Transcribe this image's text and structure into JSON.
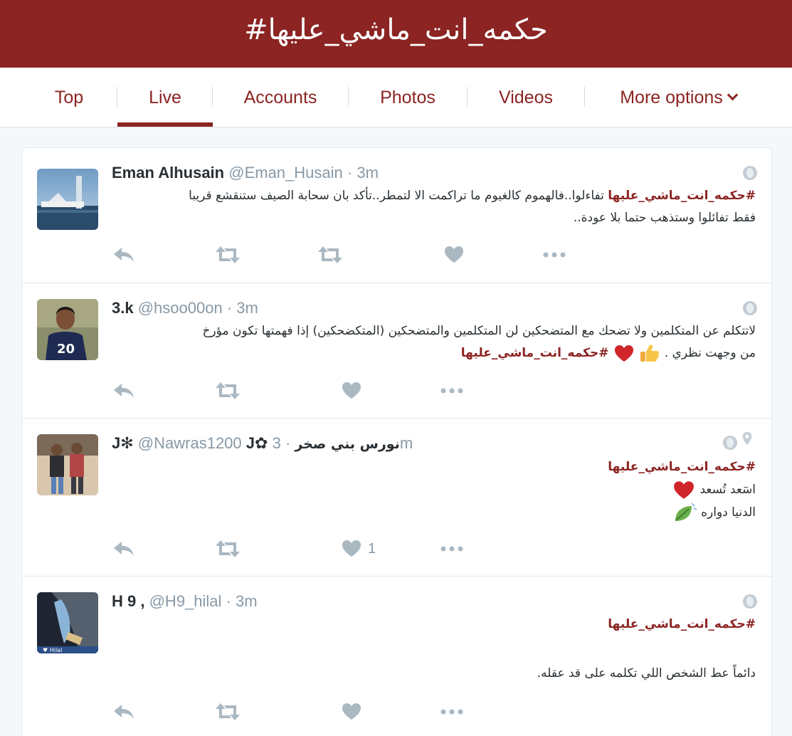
{
  "header": {
    "title": "#حكمه_انت_ماشي_عليها"
  },
  "tabs": [
    {
      "label": "Top"
    },
    {
      "label": "Live"
    },
    {
      "label": "Accounts"
    },
    {
      "label": "Photos"
    },
    {
      "label": "Videos"
    },
    {
      "label": "More options"
    }
  ],
  "colors": {
    "brand": "#8b2422",
    "muted": "#8899a6",
    "text": "#292f33"
  },
  "tweets": [
    {
      "name": "Eman Alhusain",
      "handle": "@Eman_Husain",
      "time": "3m",
      "hashtag": "#حكمه_انت_ماشي_عليها",
      "text1": "تفاءلوا..فالهموم كالغيوم ما تراكمت الا لتمطر..تأكد بان سحابة الصيف ستنقشع قريبا",
      "text2": "فقط تفائلوا وستذهب حتما بلا عودة.."
    },
    {
      "name": "3.k",
      "handle": "@hsoo00on",
      "time": "3m",
      "text1": "لاتتكلم عن المتكلمين ولا تضحك مع المتضحكين لن المتكلمين والمتضحكين (المتكضحكين) إذا فهمتها تكون مؤرخ",
      "text2": "من وجهت نظري .",
      "hashtag": "#حكمه_انت_ماشي_عليها"
    },
    {
      "name": "نورس بني صخر",
      "handle": "@Nawras1200",
      "time": "3m",
      "hashtag": "#حكمه_انت_ماشي_عليها",
      "line1": "اسٓعد تُسعد",
      "line2": "الدنيا دواره",
      "likes": "1"
    },
    {
      "name": "H 9 ,",
      "handle": "@H9_hilal",
      "time": "3m",
      "hashtag": "#حكمه_انت_ماشي_عليها",
      "text": "دائماً عط الشخص اللي تكلمه على قد عقله."
    }
  ],
  "icons": [
    "reply-icon",
    "retweet-icon",
    "like-icon",
    "more-icon",
    "globe-icon",
    "location-icon",
    "heart-emoji",
    "thumbs-up-emoji",
    "leaf-emoji"
  ]
}
